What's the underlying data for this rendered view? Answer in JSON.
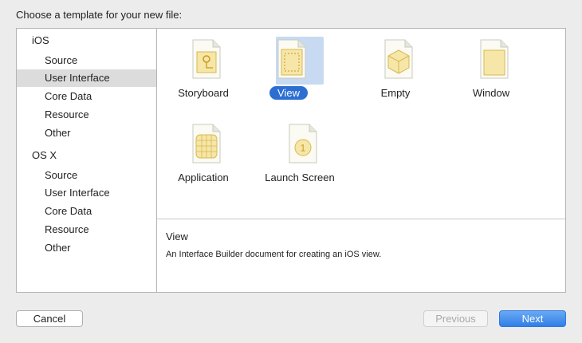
{
  "prompt": "Choose a template for your new file:",
  "sidebar": {
    "groups": [
      {
        "label": "iOS",
        "items": [
          "Source",
          "User Interface",
          "Core Data",
          "Resource",
          "Other"
        ]
      },
      {
        "label": "OS X",
        "items": [
          "Source",
          "User Interface",
          "Core Data",
          "Resource",
          "Other"
        ]
      }
    ],
    "selected": "iOS / User Interface"
  },
  "templates": [
    {
      "label": "Storyboard",
      "icon": "storyboard-icon"
    },
    {
      "label": "View",
      "icon": "view-icon",
      "selected": true
    },
    {
      "label": "Empty",
      "icon": "empty-icon"
    },
    {
      "label": "Window",
      "icon": "window-icon"
    },
    {
      "label": "Application",
      "icon": "application-icon"
    },
    {
      "label": "Launch Screen",
      "icon": "launch-screen-icon"
    }
  ],
  "description": {
    "title": "View",
    "text": "An Interface Builder document for creating an iOS view."
  },
  "buttons": {
    "cancel": "Cancel",
    "previous": "Previous",
    "next": "Next"
  },
  "colors": {
    "accent": "#2c6ed2",
    "selection_bg": "#c7daf2",
    "sidebar_selection": "#dcdcdc"
  }
}
